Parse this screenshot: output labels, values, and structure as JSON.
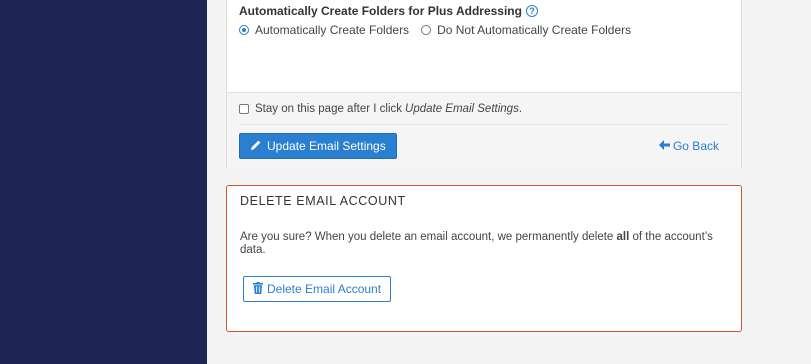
{
  "plus_addressing": {
    "label": "Automatically Create Folders for Plus Addressing",
    "help_icon": "question-circle-icon",
    "options": [
      {
        "label": "Automatically Create Folders",
        "selected": true
      },
      {
        "label": "Do Not Automatically Create Folders",
        "selected": false
      }
    ]
  },
  "footer": {
    "stay_text": "Stay on this page after I click",
    "stay_text_em": "Update Email Settings",
    "stay_text_end": ".",
    "stay_checked": false,
    "update_button": "Update Email Settings",
    "go_back": "Go Back"
  },
  "delete_section": {
    "title": "DELETE EMAIL ACCOUNT",
    "text_before": "Are you sure? When you delete an email account, we permanently delete ",
    "text_bold": "all",
    "text_after": " of the account’s data.",
    "button": "Delete Email Account"
  },
  "colors": {
    "sidebar": "#1f2655",
    "accent": "#2a7fd1",
    "danger_border": "#c9552a"
  }
}
